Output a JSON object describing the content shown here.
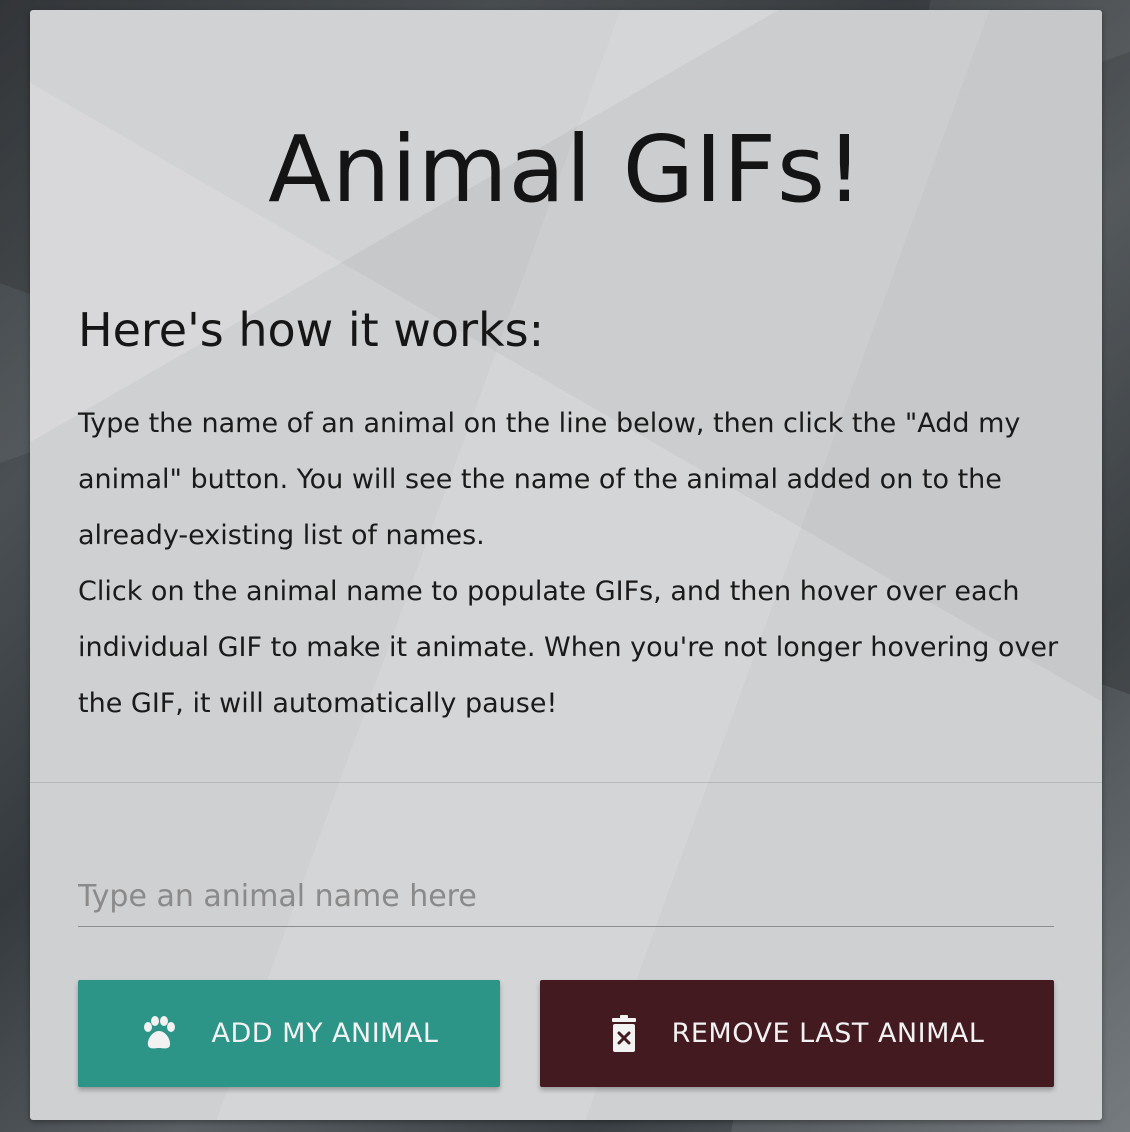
{
  "page": {
    "title": "Animal GIFs!",
    "subtitle": "Here's how it works:",
    "instructions": [
      "Type the name of an animal on the line below, then click the \"Add my animal\" button. You will see the name of the animal added on to the already-existing list of names.",
      "Click on the animal name to populate GIFs, and then hover over each individual GIF to make it animate. When you're not longer hovering over the GIF, it will automatically pause!"
    ]
  },
  "form": {
    "input_placeholder": "Type an animal name here",
    "input_value": ""
  },
  "buttons": {
    "add": {
      "label": "ADD MY ANIMAL",
      "icon": "paw-icon",
      "color": "#2d9488"
    },
    "remove": {
      "label": "REMOVE LAST ANIMAL",
      "icon": "trash-icon",
      "color": "#431a1f"
    }
  }
}
